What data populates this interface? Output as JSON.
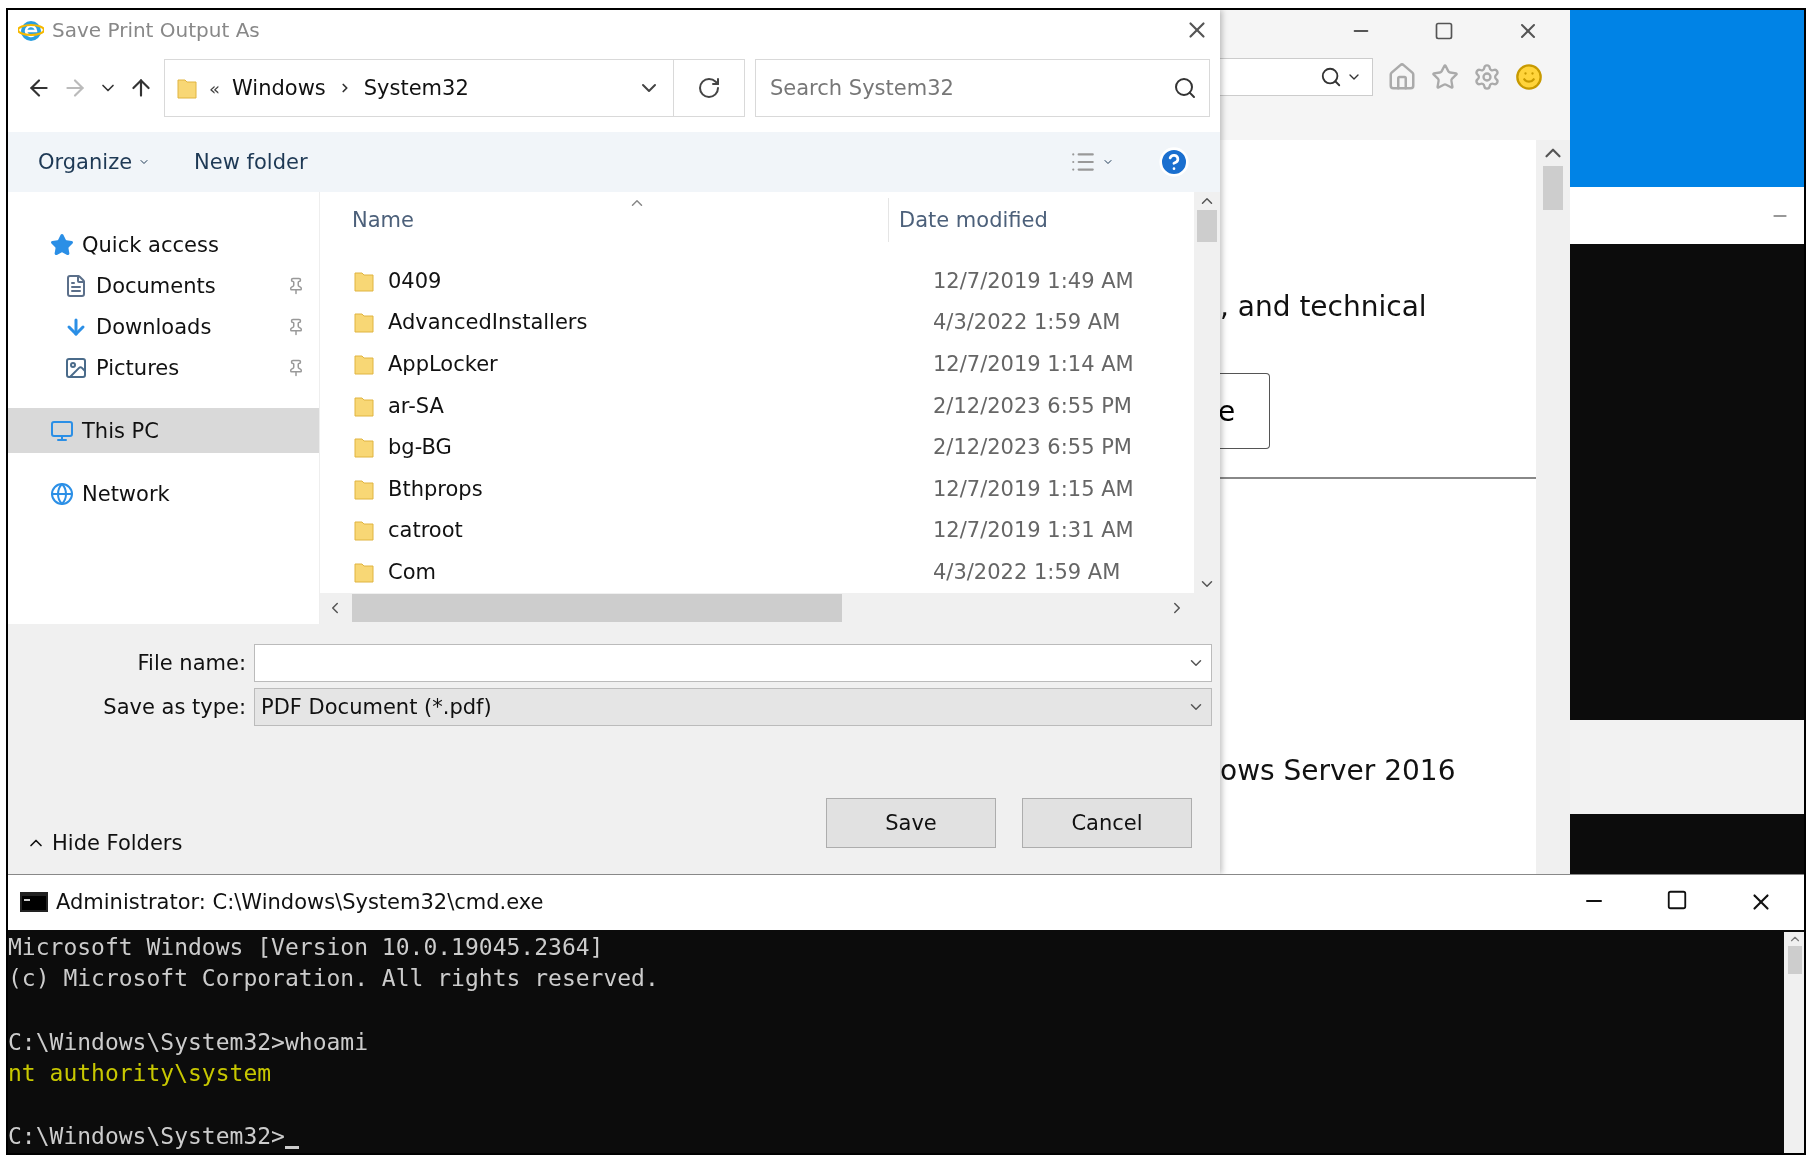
{
  "dialog": {
    "title": "Save Print Output As",
    "breadcrumb_overflow": "«",
    "breadcrumb": [
      "Windows",
      "System32"
    ],
    "search": {
      "placeholder": "Search System32"
    },
    "toolbar": [
      "Organize",
      "New folder"
    ],
    "nav": [
      {
        "label": "Quick access",
        "kind": "favorites",
        "selected": false,
        "children": [
          {
            "label": "Documents",
            "kind": "documents",
            "selected": false,
            "pinned": true
          },
          {
            "label": "Downloads",
            "kind": "downloads",
            "selected": false,
            "pinned": true
          },
          {
            "label": "Pictures",
            "kind": "pictures",
            "selected": false,
            "pinned": true
          }
        ]
      },
      {
        "label": "This PC",
        "kind": "computer",
        "selected": true
      },
      {
        "label": "Network",
        "kind": "network",
        "selected": false
      }
    ],
    "columns": [
      "Name",
      "Date modified"
    ],
    "files": [
      {
        "name": "0409",
        "date": "12/7/2019 1:49 AM"
      },
      {
        "name": "AdvancedInstallers",
        "date": "4/3/2022 1:59 AM"
      },
      {
        "name": "AppLocker",
        "date": "12/7/2019 1:14 AM"
      },
      {
        "name": "ar-SA",
        "date": "2/12/2023 6:55 PM"
      },
      {
        "name": "bg-BG",
        "date": "2/12/2023 6:55 PM"
      },
      {
        "name": "Bthprops",
        "date": "12/7/2019 1:15 AM"
      },
      {
        "name": "catroot",
        "date": "12/7/2019 1:31 AM"
      },
      {
        "name": "Com",
        "date": "4/3/2022 1:59 AM"
      }
    ],
    "file_name": {
      "label": "File name:"
    },
    "save_type": {
      "label": "Save as type:",
      "value": "PDF Document (*.pdf)"
    },
    "buttons": [
      "Save",
      "Cancel"
    ],
    "hide_folders": "Hide Folders"
  },
  "browser": {
    "texts": [
      ", and technical",
      "e",
      "ows Server 2016"
    ]
  },
  "cmd": {
    "title": "Administrator: C:\\Windows\\System32\\cmd.exe",
    "lines": [
      {
        "text": "Microsoft Windows [Version 10.0.19045.2364]",
        "kind": "output",
        "cursor": false
      },
      {
        "text": "(c) Microsoft Corporation. All rights reserved.",
        "kind": "output",
        "cursor": false
      },
      {
        "kind": "blank"
      },
      {
        "text": "C:\\Windows\\System32>whoami",
        "kind": "output",
        "cursor": false
      },
      {
        "text": "nt authority\\system",
        "kind": "highlight",
        "cursor": false
      },
      {
        "kind": "blank"
      },
      {
        "text": "C:\\Windows\\System32>",
        "kind": "output",
        "cursor": true
      }
    ]
  }
}
